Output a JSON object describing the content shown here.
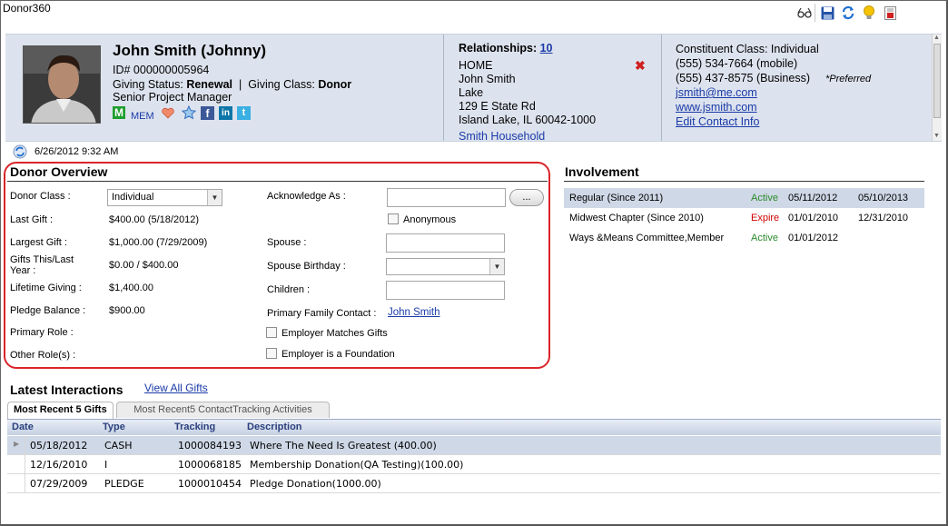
{
  "app": {
    "title": "Donor360"
  },
  "toolbar": {
    "icons": [
      "glasses-icon",
      "save-icon",
      "refresh-icon",
      "lightbulb-icon",
      "report-icon"
    ]
  },
  "constituent": {
    "name": "John Smith (Johnny)",
    "id_text": "ID# 000000005964",
    "giving_status_label": "Giving Status:",
    "giving_status": "Renewal",
    "separator": "|",
    "giving_class_label": "Giving Class:",
    "giving_class": "Donor",
    "title": "Senior Project Manager",
    "membership_badge": "M",
    "membership_code": "MEM"
  },
  "relationships": {
    "label": "Relationships:",
    "count": "10",
    "address_type": "HOME",
    "address_name": "John Smith",
    "address_line2": "Lake",
    "street": "129 E State Rd",
    "city": "Island Lake, IL 60042-1000",
    "household_link": "Smith Household"
  },
  "contact": {
    "class_line": "Constituent Class: Individual",
    "phone_mobile": "(555) 534-7664 (mobile)",
    "phone_business": "(555) 437-8575 (Business)",
    "preferred": "*Preferred",
    "email": "jsmith@me.com",
    "website": "www.jsmith.com",
    "edit_link": "Edit Contact Info"
  },
  "last_refresh": "6/26/2012 9:32 AM",
  "donor_overview": {
    "title": "Donor Overview",
    "donor_class_label": "Donor Class :",
    "donor_class_value": "Individual",
    "last_gift_label": "Last Gift :",
    "last_gift_value": "$400.00 (5/18/2012)",
    "largest_gift_label": "Largest Gift :",
    "largest_gift_value": "$1,000.00 (7/29/2009)",
    "gifts_this_last_label_1": "Gifts This/Last",
    "gifts_this_last_label_2": "Year :",
    "gifts_this_last_value": "$0.00 / $400.00",
    "lifetime_label": "Lifetime Giving :",
    "lifetime_value": "$1,400.00",
    "pledge_label": "Pledge Balance :",
    "pledge_value": "$900.00",
    "primary_role_label": "Primary Role :",
    "other_roles_label": "Other Role(s) :",
    "acknowledge_label": "Acknowledge As :",
    "acknowledge_value": "",
    "dots_button": "...",
    "anonymous_label": "Anonymous",
    "spouse_label": "Spouse :",
    "spouse_birthday_label": "Spouse Birthday :",
    "children_label": "Children :",
    "primary_family_label": "Primary Family Contact :",
    "primary_family_value": "John Smith",
    "employer_matches_label": "Employer Matches Gifts",
    "employer_foundation_label": "Employer is a Foundation"
  },
  "involvement": {
    "title": "Involvement",
    "rows": [
      {
        "name": "Regular (Since 2011)",
        "status": "Active",
        "start": "05/11/2012",
        "end": "05/10/2013"
      },
      {
        "name": "Midwest Chapter (Since 2010)",
        "status": "Expire",
        "start": "01/01/2010",
        "end": "12/31/2010"
      },
      {
        "name": "Ways &Means Committee,Member",
        "status": "Active",
        "start": "01/01/2012",
        "end": ""
      }
    ]
  },
  "interactions": {
    "title": "Latest Interactions",
    "view_all": "View All Gifts",
    "tabs": [
      "Most Recent 5 Gifts",
      "Most Recent5 ContactTracking Activities"
    ],
    "columns": [
      "Date",
      "Type",
      "Tracking",
      "Description"
    ],
    "rows": [
      {
        "date": "05/18/2012",
        "type": "CASH",
        "tracking": "1000084193",
        "description": "Where The Need Is Greatest (400.00)"
      },
      {
        "date": "12/16/2010",
        "type": "I",
        "tracking": "1000068185",
        "description": "Membership Donation(QA Testing)(100.00)"
      },
      {
        "date": "07/29/2009",
        "type": "PLEDGE",
        "tracking": "1000010454",
        "description": "Pledge Donation(1000.00)"
      }
    ]
  },
  "colors": {
    "header_bg": "#dde3ee",
    "link": "#1a3aa8",
    "active": "#2a8a2a",
    "expire": "#d00000",
    "highlight": "#d9252b",
    "selected_row": "#cfd8e6"
  }
}
